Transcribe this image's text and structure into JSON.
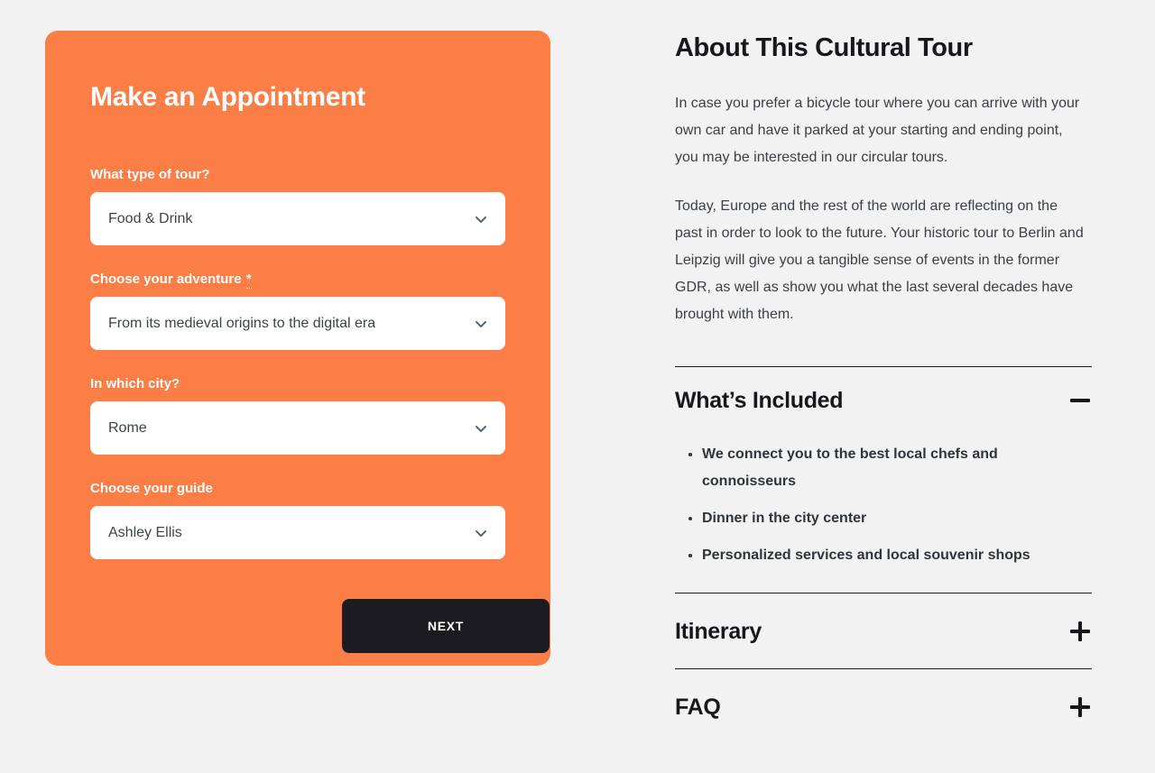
{
  "page": {
    "background_color": "#f2f2f2"
  },
  "form": {
    "accent_color": "#fa7e46",
    "title": "Make an Appointment",
    "fields": [
      {
        "label": "What type of tour?",
        "required_marker": "",
        "value": "Food & Drink",
        "icon": "chevron-down-icon"
      },
      {
        "label": "Choose your adventure",
        "required_marker": "*",
        "value": "From its medieval origins to the digital era",
        "icon": "chevron-down-icon"
      },
      {
        "label": "In which city?",
        "required_marker": "",
        "value": "Rome",
        "icon": "chevron-down-icon"
      },
      {
        "label": "Choose your guide",
        "required_marker": "",
        "value": "Ashley Ellis",
        "icon": "chevron-down-icon"
      }
    ],
    "next_label": "NEXT"
  },
  "about": {
    "title": "About This Cultural Tour",
    "paragraphs": [
      "In case you prefer a bicycle tour where you can arrive with your own car and have it parked at your starting and ending point, you may be interested in our circular tours.",
      "Today, Europe and the rest of the world are reflecting on the past in order to look to the future. Your historic tour to Berlin and Leipzig will give you a tangible sense of events in the former GDR, as well as show you what the last several decades have brought with them."
    ]
  },
  "accordion": {
    "items": [
      {
        "title": "What’s Included",
        "expanded": true,
        "icon": "minus-icon",
        "bullets": [
          "We connect you to the best local chefs and connoisseurs",
          "Dinner in the city center",
          "Personalized services and local souvenir shops"
        ]
      },
      {
        "title": "Itinerary",
        "expanded": false,
        "icon": "plus-icon",
        "bullets": []
      },
      {
        "title": "FAQ",
        "expanded": false,
        "icon": "plus-icon",
        "bullets": []
      }
    ]
  }
}
